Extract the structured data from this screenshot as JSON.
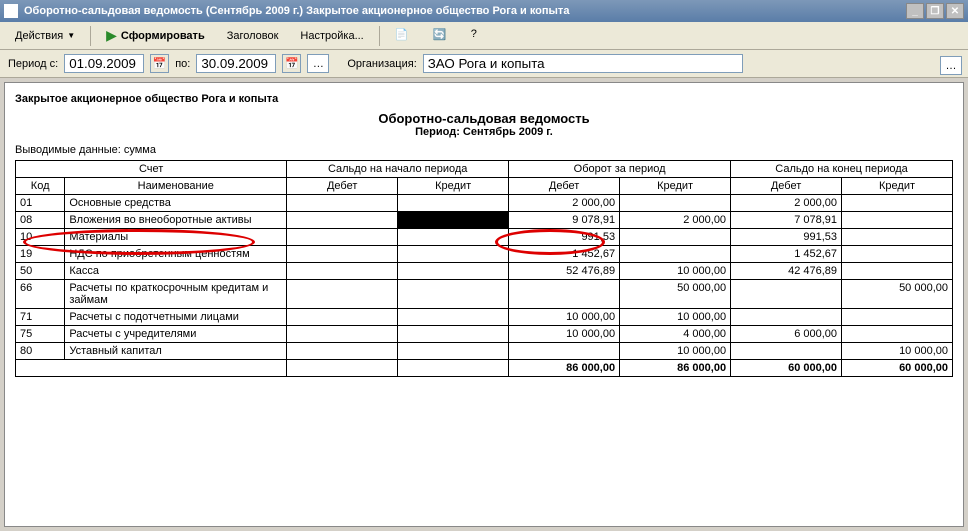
{
  "window": {
    "title": "Оборотно-сальдовая ведомость (Сентябрь 2009 г.) Закрытое акционерное общество Рога и копыта"
  },
  "toolbar": {
    "actions": "Действия",
    "form": "Сформировать",
    "header": "Заголовок",
    "settings": "Настройка..."
  },
  "params": {
    "period_from_label": "Период с:",
    "period_from": "01.09.2009",
    "to_label": "по:",
    "period_to": "30.09.2009",
    "org_label": "Организация:",
    "org_value": "ЗАО Рога и копыта"
  },
  "report": {
    "org_header": "Закрытое акционерное общество Рога и копыта",
    "title": "Оборотно-сальдовая ведомость",
    "period": "Период: Сентябрь 2009 г.",
    "subtitle": "Выводимые данные: сумма",
    "hdr_account": "Счет",
    "hdr_start": "Сальдо на начало периода",
    "hdr_turn": "Оборот за период",
    "hdr_end": "Сальдо на конец периода",
    "hdr_code": "Код",
    "hdr_name": "Наименование",
    "hdr_debit": "Дебет",
    "hdr_credit": "Кредит",
    "rows": [
      {
        "code": "01",
        "name": "Основные средства",
        "sd": "",
        "sc": "",
        "td": "2 000,00",
        "tc": "",
        "ed": "2 000,00",
        "ec": ""
      },
      {
        "code": "08",
        "name": "Вложения во внеоборотные активы",
        "sd": "",
        "sc": "",
        "td": "9 078,91",
        "tc": "2 000,00",
        "ed": "7 078,91",
        "ec": ""
      },
      {
        "code": "10",
        "name": "Материалы",
        "sd": "",
        "sc": "",
        "td": "991,53",
        "tc": "",
        "ed": "991,53",
        "ec": ""
      },
      {
        "code": "19",
        "name": "НДС по приобретенным ценностям",
        "sd": "",
        "sc": "",
        "td": "1 452,67",
        "tc": "",
        "ed": "1 452,67",
        "ec": ""
      },
      {
        "code": "50",
        "name": "Касса",
        "sd": "",
        "sc": "",
        "td": "52 476,89",
        "tc": "10 000,00",
        "ed": "42 476,89",
        "ec": ""
      },
      {
        "code": "66",
        "name": "Расчеты по краткосрочным кредитам и займам",
        "sd": "",
        "sc": "",
        "td": "",
        "tc": "50 000,00",
        "ed": "",
        "ec": "50 000,00"
      },
      {
        "code": "71",
        "name": "Расчеты с подотчетными лицами",
        "sd": "",
        "sc": "",
        "td": "10 000,00",
        "tc": "10 000,00",
        "ed": "",
        "ec": ""
      },
      {
        "code": "75",
        "name": "Расчеты с учредителями",
        "sd": "",
        "sc": "",
        "td": "10 000,00",
        "tc": "4 000,00",
        "ed": "6 000,00",
        "ec": ""
      },
      {
        "code": "80",
        "name": "Уставный капитал",
        "sd": "",
        "sc": "",
        "td": "",
        "tc": "10 000,00",
        "ed": "",
        "ec": "10 000,00"
      }
    ],
    "total": {
      "sd": "",
      "sc": "",
      "td": "86 000,00",
      "tc": "86 000,00",
      "ed": "60 000,00",
      "ec": "60 000,00"
    }
  }
}
